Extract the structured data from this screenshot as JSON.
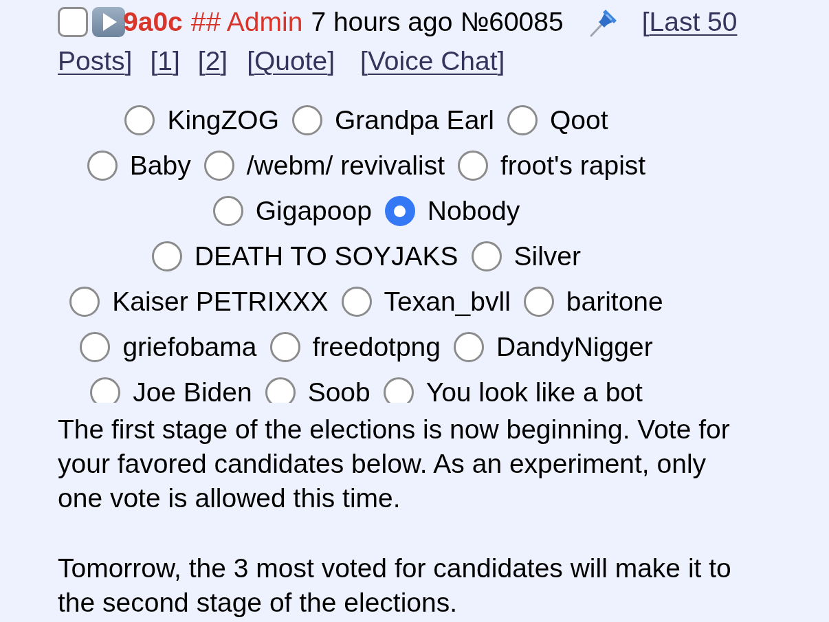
{
  "post": {
    "checkbox": {
      "checked": false
    },
    "name": "9a0c",
    "capcode": "## Admin",
    "time": "7 hours ago",
    "number": "№60085",
    "sticky": true,
    "links": [
      {
        "open": "[",
        "parts": [
          "Last 50",
          "Posts"
        ],
        "close": "]"
      },
      {
        "open": "[",
        "parts": [
          "1"
        ],
        "close": "]"
      },
      {
        "open": "[",
        "parts": [
          "2"
        ],
        "close": "]"
      },
      {
        "open": "[",
        "parts": [
          "Quote"
        ],
        "close": "]"
      },
      {
        "open": "[",
        "parts": [
          "Voice Chat"
        ],
        "close": "]"
      }
    ]
  },
  "poll": {
    "options": [
      {
        "label": "KingZOG",
        "selected": false
      },
      {
        "label": "Grandpa Earl",
        "selected": false
      },
      {
        "label": "Qoot",
        "selected": false
      },
      {
        "label": "Baby",
        "selected": false
      },
      {
        "label": "/webm/ revivalist",
        "selected": false
      },
      {
        "label": "froot's rapist",
        "selected": false
      },
      {
        "label": "Gigapoop",
        "selected": false
      },
      {
        "label": "Nobody",
        "selected": true
      },
      {
        "label": "DEATH TO SOYJAKS",
        "selected": false
      },
      {
        "label": "Silver",
        "selected": false
      },
      {
        "label": "Kaiser PETRIXXX",
        "selected": false
      },
      {
        "label": "Texan_bvll",
        "selected": false
      },
      {
        "label": "baritone",
        "selected": false
      },
      {
        "label": "griefobama",
        "selected": false
      },
      {
        "label": "freedotpng",
        "selected": false
      },
      {
        "label": "DandyNigger",
        "selected": false
      },
      {
        "label": "Joe Biden",
        "selected": false
      },
      {
        "label": "Soob",
        "selected": false
      },
      {
        "label": "You look like a bot",
        "selected": false
      }
    ]
  },
  "message": [
    "The first stage of the elections is now beginning. Vote for your favored candidates below. As an experiment, only one vote is allowed this time.",
    "Tomorrow, the 3 most voted for candidates will make it to the second stage of the elections."
  ]
}
